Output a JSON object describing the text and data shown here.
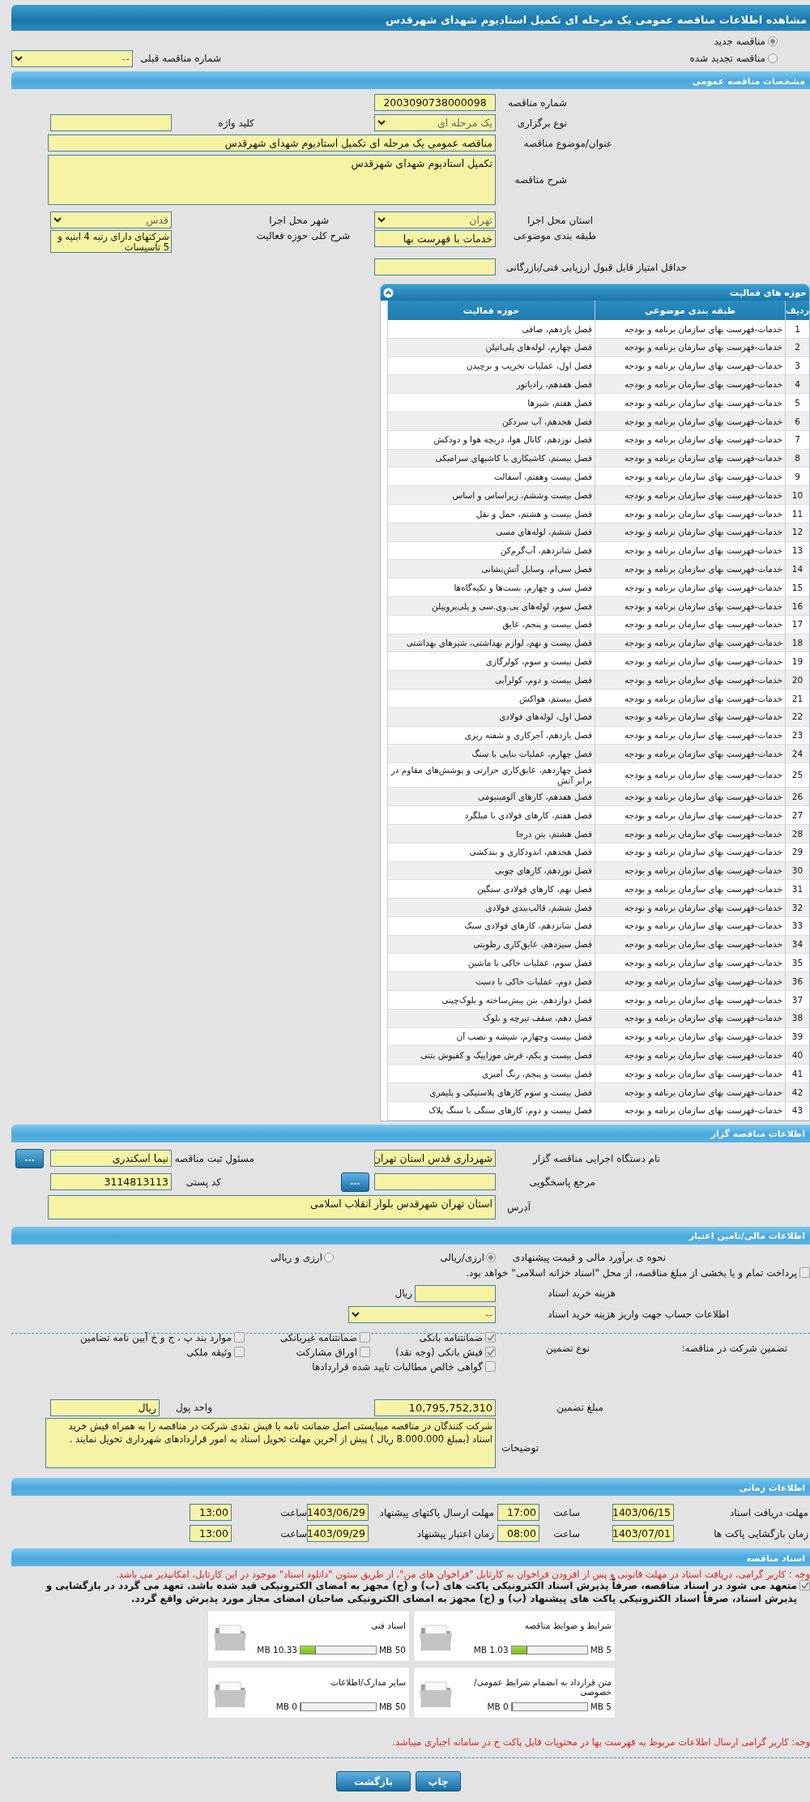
{
  "page_title": "مشاهده اطلاعات مناقصه عمومی یک مرحله ای تکمیل استادیوم شهدای شهرقدس",
  "tender_kind": [
    {
      "label": "مناقصه جدید",
      "selected": true
    },
    {
      "label": "مناقصه تجدید شده",
      "selected": false
    }
  ],
  "previous_tender": {
    "label": "شماره مناقصه قبلی",
    "value": "--"
  },
  "general": {
    "title": "مشخصات مناقصه عمومی",
    "tender_number": {
      "label": "شماره مناقصه",
      "value": "2003090738000098"
    },
    "holding_type": {
      "label": "نوع برگزاری",
      "value": "یک مرحله ای"
    },
    "keyword": {
      "label": "کلید واژه"
    },
    "subject": {
      "label": "عنوان/موضوع مناقصه",
      "value": "مناقصه عمومی یک مرحله ای تکمیل استادیوم شهدای شهرقدس"
    },
    "description": {
      "label": "شرح مناقصه",
      "value": "تکمیل استادیوم شهدای شهرقدس"
    },
    "province": {
      "label": "استان محل اجرا",
      "value": "تهران"
    },
    "city": {
      "label": "شهر محل اجرا",
      "value": "قدس"
    },
    "category": {
      "label": "طبقه بندی موضوعی",
      "value": "خدمات با فهرست بها"
    },
    "activity_scope": {
      "label": "شرح کلی حوزه فعالیت",
      "value": "شرکتهای دارای رتبه 4 ابنیه و 5 تاسیسات"
    },
    "min_score": {
      "label": "حداقل امتیاز قابل قبول ارزیابی فنی/بازرگانی"
    }
  },
  "activity_table": {
    "title": "حوزه های فعالیت",
    "columns": [
      "ردیف",
      "طبقه بندی موضوعی",
      "حوزه فعالیت"
    ],
    "rows": [
      {
        "number": "1",
        "category": "خدمات-فهرست بهای سازمان برنامه و بودجه",
        "activity": "فصل یازدهم، صافی"
      },
      {
        "number": "2",
        "category": "خدمات-فهرست بهای سازمان برنامه و بودجه",
        "activity": "فصل چهارم، لوله‌های پلی‌اتیلن"
      },
      {
        "number": "3",
        "category": "خدمات-فهرست بهای سازمان برنامه و بودجه",
        "activity": "فصل اول، عملیات تخریب و برچیدن"
      },
      {
        "number": "4",
        "category": "خدمات-فهرست بهای سازمان برنامه و بودجه",
        "activity": "فصل هفدهم، رادیاتور"
      },
      {
        "number": "5",
        "category": "خدمات-فهرست بهای سازمان برنامه و بودجه",
        "activity": "فصل هفتم، شیرها"
      },
      {
        "number": "6",
        "category": "خدمات-فهرست بهای سازمان برنامه و بودجه",
        "activity": "فصل هجدهم، آب سردکن"
      },
      {
        "number": "7",
        "category": "خدمات-فهرست بهای سازمان برنامه و بودجه",
        "activity": "فصل نوزدهم، کانال هوا، دریچه هوا و دودکش"
      },
      {
        "number": "8",
        "category": "خدمات-فهرست بهای سازمان برنامه و بودجه",
        "activity": "فصل بیستم، کاشیکاری با کاشیهای سرامیکی"
      },
      {
        "number": "9",
        "category": "خدمات-فهرست بهای سازمان برنامه و بودجه",
        "activity": "فصل بیست وهفتم، آسفالت"
      },
      {
        "number": "10",
        "category": "خدمات-فهرست بهای سازمان برنامه و بودجه",
        "activity": "فصل بیست وششم، زیراساس و اساس"
      },
      {
        "number": "11",
        "category": "خدمات-فهرست بهای سازمان برنامه و بودجه",
        "activity": "فصل بیست و هشتم، حمل و نقل"
      },
      {
        "number": "12",
        "category": "خدمات-فهرست بهای سازمان برنامه و بودجه",
        "activity": "فصل ششم، لوله‌های مسی"
      },
      {
        "number": "13",
        "category": "خدمات-فهرست بهای سازمان برنامه و بودجه",
        "activity": "فصل شانزدهم، آب‌گرم‌کن"
      },
      {
        "number": "14",
        "category": "خدمات-فهرست بهای سازمان برنامه و بودجه",
        "activity": "فصل سی‌ام، وسایل آتش‌نشانی"
      },
      {
        "number": "15",
        "category": "خدمات-فهرست بهای سازمان برنامه و بودجه",
        "activity": "فصل سی و چهارم، بست‌ها و تکیه‌گاه‌ها"
      },
      {
        "number": "16",
        "category": "خدمات-فهرست بهای سازمان برنامه و بودجه",
        "activity": "فصل سوم، لوله‌های پی‌.وی‌.سی و پلی‌پروپیلن"
      },
      {
        "number": "17",
        "category": "خدمات-فهرست بهای سازمان برنامه و بودجه",
        "activity": "فصل بیست و پنجم، عایق"
      },
      {
        "number": "18",
        "category": "خدمات-فهرست بهای سازمان برنامه و بودجه",
        "activity": "فصل بیست و نهم، لوازم بهداشتی، شیرهای بهداشتی"
      },
      {
        "number": "19",
        "category": "خدمات-فهرست بهای سازمان برنامه و بودجه",
        "activity": "فصل بیست و سوم، کولرگازی"
      },
      {
        "number": "20",
        "category": "خدمات-فهرست بهای سازمان برنامه و بودجه",
        "activity": "فصل بیست و دوم، کولرآبی"
      },
      {
        "number": "21",
        "category": "خدمات-فهرست بهای سازمان برنامه و بودجه",
        "activity": "فصل بیستم، هواکش"
      },
      {
        "number": "22",
        "category": "خدمات-فهرست بهای سازمان برنامه و بودجه",
        "activity": "فصل اول، لوله‌های فولادی"
      },
      {
        "number": "23",
        "category": "خدمات-فهرست بهای سازمان برنامه و بودجه",
        "activity": "فصل یازدهم، آجرکاری و شفته ریزی"
      },
      {
        "number": "24",
        "category": "خدمات-فهرست بهای سازمان برنامه و بودجه",
        "activity": "فصل چهارم، عملیات بنایی با سنگ"
      },
      {
        "number": "25",
        "category": "خدمات-فهرست بهای سازمان برنامه و بودجه",
        "activity": "فصل چهاردهم، عایق‌کاری حرارتی و پوشش‌های مقاوم در برابر آتش"
      },
      {
        "number": "26",
        "category": "خدمات-فهرست بهای سازمان برنامه و بودجه",
        "activity": "فصل هفدهم، کارهای آلومینیومی"
      },
      {
        "number": "27",
        "category": "خدمات-فهرست بهای سازمان برنامه و بودجه",
        "activity": "فصل هفتم، کارهای فولادی با میلگرد"
      },
      {
        "number": "28",
        "category": "خدمات-فهرست بهای سازمان برنامه و بودجه",
        "activity": "فصل هشتم، بتن درجا"
      },
      {
        "number": "29",
        "category": "خدمات-فهرست بهای سازمان برنامه و بودجه",
        "activity": "فصل هجدهم، اندودکاری و بندکشی"
      },
      {
        "number": "30",
        "category": "خدمات-فهرست بهای سازمان برنامه و بودجه",
        "activity": "فصل نوزدهم، کارهای چوبی"
      },
      {
        "number": "31",
        "category": "خدمات-فهرست بهای سازمان برنامه و بودجه",
        "activity": "فصل نهم، کارهای فولادی سنگین"
      },
      {
        "number": "32",
        "category": "خدمات-فهرست بهای سازمان برنامه و بودجه",
        "activity": "فصل ششم، قالب‌بندی فولادی"
      },
      {
        "number": "33",
        "category": "خدمات-فهرست بهای سازمان برنامه و بودجه",
        "activity": "فصل شانزدهم، کارهای فولادی سبک"
      },
      {
        "number": "34",
        "category": "خدمات-فهرست بهای سازمان برنامه و بودجه",
        "activity": "فصل سیزدهم، عایق‌کاری رطوبتی"
      },
      {
        "number": "35",
        "category": "خدمات-فهرست بهای سازمان برنامه و بودجه",
        "activity": "فصل سوم، عملیات خاکی با ماشین"
      },
      {
        "number": "36",
        "category": "خدمات-فهرست بهای سازمان برنامه و بودجه",
        "activity": "فصل دوم، عملیات خاکی با دست"
      },
      {
        "number": "37",
        "category": "خدمات-فهرست بهای سازمان برنامه و بودجه",
        "activity": "فصل دوازدهم، بتن پیش‌ساخته و بلوک‌چینی"
      },
      {
        "number": "38",
        "category": "خدمات-فهرست بهای سازمان برنامه و بودجه",
        "activity": "فصل دهم، سقف تیرچه و بلوک"
      },
      {
        "number": "39",
        "category": "خدمات-فهرست بهای سازمان برنامه و بودجه",
        "activity": "فصل بیست وچهارم، شیشه و نصب آن"
      },
      {
        "number": "40",
        "category": "خدمات-فهرست بهای سازمان برنامه و بودجه",
        "activity": "فصل بیست و یکم، فرش موزاییک و کفپوش بتنی"
      },
      {
        "number": "41",
        "category": "خدمات-فهرست بهای سازمان برنامه و بودجه",
        "activity": "فصل بیست و پنجم، رنگ آمیزی"
      },
      {
        "number": "42",
        "category": "خدمات-فهرست بهای سازمان برنامه و بودجه",
        "activity": "فصل بیست و سوم کارهای پلاستیکی و پلیمری"
      },
      {
        "number": "43",
        "category": "خدمات-فهرست بهای سازمان برنامه و بودجه",
        "activity": "فصل بیست و دوم، کارهای سنگی با سنگ پلاک"
      }
    ]
  },
  "organizer": {
    "title": "اطلاعات مناقصه گزار",
    "agency": {
      "label": "نام دستگاه اجرایی مناقصه گزار",
      "value": "شهرداری قدس استان تهران"
    },
    "registrar": {
      "label": "مسئول ثبت مناقصه",
      "value": "نیما اسکندری",
      "button": "..."
    },
    "response_ref": {
      "label": "مرجع پاسخگویی",
      "button": "..."
    },
    "postal_code": {
      "label": "کد پستی",
      "value": "3114813113"
    },
    "address": {
      "label": "آدرس",
      "value": "استان تهران شهرقدس بلوار انقلاب اسلامی"
    }
  },
  "finance": {
    "title": "اطلاعات مالی/تامین اعتبار",
    "estimate_method": {
      "label": "نحوه ی برآورد مالی و قیمت پیشنهادی",
      "options": [
        {
          "label": "ارزی/ریالی",
          "selected": true
        },
        {
          "label": "ارزی و ریالی",
          "selected": false
        }
      ]
    },
    "treasury_payment": {
      "label": "پرداخت تمام و یا بخشی از مبلغ مناقصه، از محل \"اسناد خزانه اسلامی\" خواهد بود.",
      "checked": false
    },
    "doc_fee": {
      "label": "هزینه خرید اسناد",
      "unit": "ریال"
    },
    "account": {
      "label": "اطلاعات حساب جهت واریز هزینه خرید اسناد",
      "value": "--"
    }
  },
  "guarantee": {
    "label": "تضمین شرکت در مناقصه:",
    "type_label": "نوع تضمین",
    "options": [
      {
        "label": "ضمانتنامه بانکی",
        "checked": true
      },
      {
        "label": "ضمانتنامه غیربانکی",
        "checked": false
      },
      {
        "label": "موارد بند پ ، ج و خ آیین نامه تضامین",
        "checked": false
      },
      {
        "label": "فیش بانکی (وجه نقد)",
        "checked": true
      },
      {
        "label": "اوراق مشارکت",
        "checked": false
      },
      {
        "label": "وثیقه ملکی",
        "checked": false
      },
      {
        "label": "گواهی خالص مطالبات تایید شده قراردادها",
        "checked": false
      }
    ],
    "amount": {
      "label": "مبلغ تضمین",
      "value": "10,795,752,310"
    },
    "currency": {
      "label": "واحد پول",
      "value": "ریال"
    },
    "notes": {
      "label": "توضیحات",
      "value": "شرکت کنندگان در مناقصه میبایستی اصل ضمانت نامه یا فیش نقدی شرکت در مناقصه  را به همراه فیش خرید اسناد (بمبلغ 8.000.000 ریال )  پیش از آخرین مهلت تحویل اسناد به امور قراردادهای شهرداری تحویل نمایند ."
    }
  },
  "timing": {
    "title": "اطلاعات زمانی",
    "items": [
      {
        "label": "مهلت دریافت اسناد",
        "date": "1403/06/15",
        "time_label": "ساعت",
        "time": "17:00"
      },
      {
        "label": "مهلت ارسال پاکتهای پیشنهاد",
        "date": "1403/06/29",
        "time_label": "ساعت",
        "time": "13:00"
      },
      {
        "label": "زمان بازگشایی پاکت ها",
        "date": "1403/07/01",
        "time_label": "ساعت",
        "time": "08:00"
      },
      {
        "label": "زمان اعتبار پیشنهاد",
        "date": "1403/09/29",
        "time_label": "ساعت",
        "time": "13:00"
      }
    ]
  },
  "documents": {
    "title": "اسناد مناقصه",
    "notice": "وجه : کاربر گرامی، دریافت اسناد در مهلت قانونی و پس از افزودن فراخوان به کارتابل \"فراخوان های من\"، از طریق ستون \"دانلود اسناد\" موجود در این کارتابل، امکانپذیر می باشد.",
    "commitment": {
      "checked": true,
      "text": "متعهد می شود در اسناد مناقصه، صرفاً پذیرش اسناد الکترونیکی پاکت های (ب) و (ج) مجهز به امضای الکترونیکی قید شده باشد. تعهد می گردد در بازگشایی و پذیرش اسناد، صرفاً اسناد الکترونیکی پاکت های پیشنهاد (ب) و (ج) مجهز به امضای الکترونیکی صاحبان امضای مجاز مورد پذیرش واقع گردد."
    },
    "files": [
      {
        "name": "شرایط و ضوابط مناقصه",
        "size": "1.03 MB",
        "limit": "5 MB",
        "level": 0.206
      },
      {
        "name": "اسناد فنی",
        "size": "10.33 MB",
        "limit": "50 MB",
        "level": 0.207
      },
      {
        "name": "متن قرارداد به انضمام شرایط عمومی/خصوصی",
        "size": "0 MB",
        "limit": "5 MB",
        "level": 0
      },
      {
        "name": "سایر مدارک/اطلاعات",
        "size": "0 MB",
        "limit": "50 MB",
        "level": 0
      }
    ],
    "footnote": "وجه: کاربر گرامی ارسال اطلاعات مربوط به فهرست بها در محتویات فایل پاکت ج در سامانه اجباری میباشد."
  },
  "buttons": [
    "چاپ",
    "بازگشت"
  ]
}
